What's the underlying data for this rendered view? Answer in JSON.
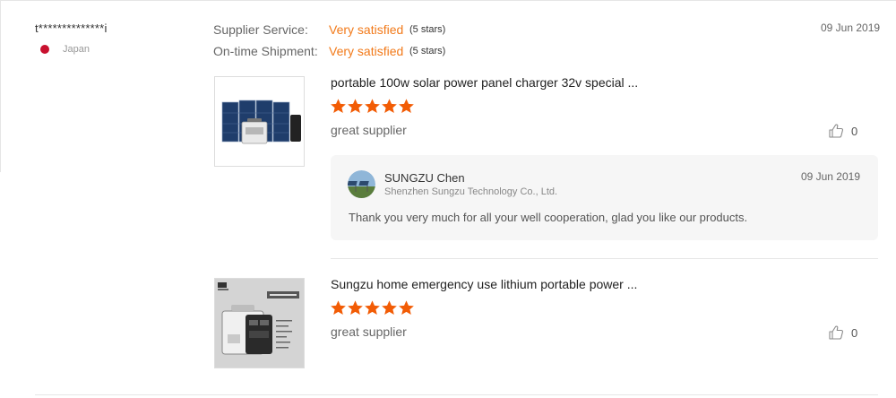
{
  "review": {
    "user_name": "t**************i",
    "country": "Japan",
    "date": "09 Jun 2019",
    "ratings": [
      {
        "label": "Supplier Service:",
        "value": "Very satisfied",
        "stars": "(5 stars)"
      },
      {
        "label": "On-time Shipment:",
        "value": "Very satisfied",
        "stars": "(5 stars)"
      }
    ],
    "products": [
      {
        "title": "portable 100w solar power panel charger 32v special ...",
        "rating": 5,
        "comment": "great supplier",
        "helpful_count": "0",
        "image_icon": "solar-panel-kit-image"
      },
      {
        "title": "Sungzu home emergency use lithium portable power ...",
        "rating": 5,
        "comment": "great supplier",
        "helpful_count": "0",
        "image_icon": "portable-power-station-image"
      }
    ],
    "reply": {
      "name": "SUNGZU Chen",
      "company": "Shenzhen Sungzu Technology Co., Ltd.",
      "date": "09 Jun 2019",
      "text": "Thank you very much for all your well cooperation, glad you like our products."
    }
  },
  "colors": {
    "accent": "#f27a1a",
    "star": "#f25c05",
    "flag": "#c8102e"
  }
}
